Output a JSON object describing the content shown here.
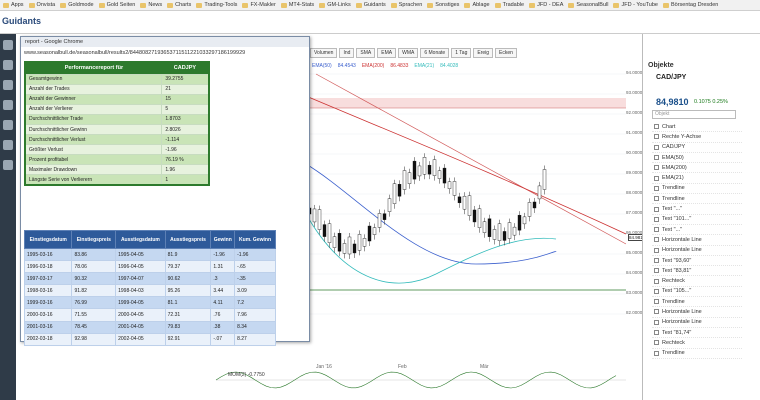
{
  "bookmarks": [
    "Apps",
    "Onvista",
    "Goldmode",
    "Gold Seiten",
    "News",
    "Charts",
    "Trading-Tools",
    "FX-Makler",
    "MT4-Stats",
    "GM-Links",
    "Guidants",
    "Sprachen",
    "Sonstiges",
    "Ablage",
    "Tradable",
    "JFD - DEA",
    "SeasonalBull",
    "JFD - YouTube",
    "Börsentag Dresden"
  ],
  "app": {
    "logo": "Guidants"
  },
  "popup": {
    "window_title": "report - Google Chrome",
    "url": "www.seasonalbull.de/seasonalbull/results2/84480827193653711511221033297186199929",
    "perf_header_left": "Performancereport für",
    "perf_header_right": "CADJPY",
    "perf_rows": [
      [
        "Gesamtgewinn",
        "39.2755"
      ],
      [
        "Anzahl der Trades",
        "21"
      ],
      [
        "Anzahl der Gewinner",
        "15"
      ],
      [
        "Anzahl der Verlierer",
        "5"
      ],
      [
        "Durchschnittlicher Trade",
        "1.8703"
      ],
      [
        "Durchschnittlicher Gewinn",
        "2.8026"
      ],
      [
        "Durchschnittlicher Verlust",
        "-1.114"
      ],
      [
        "Größter Verlust",
        "-1.96"
      ],
      [
        "Prozent profitabel",
        "76.19 %"
      ],
      [
        "Maximaler Drawdown",
        "1.96"
      ],
      [
        "Längste Serie von Verlierern",
        "1"
      ]
    ],
    "trade_headers": [
      "Einstiegsdatum",
      "Einstiegspreis",
      "Ausstiegsdatum",
      "Ausstiegspreis",
      "Gewinn",
      "Kum. Gewinn"
    ],
    "trade_rows": [
      [
        "1995-03-16",
        "83.86",
        "1995-04-05",
        "81.9",
        "-1.96",
        "-1.96"
      ],
      [
        "1996-03-18",
        "78.06",
        "1996-04-05",
        "79.37",
        "1.31",
        "-.65"
      ],
      [
        "1997-03-17",
        "90.32",
        "1997-04-07",
        "90.62",
        ".3",
        "-.35"
      ],
      [
        "1998-03-16",
        "91.82",
        "1998-04-03",
        "95.26",
        "3.44",
        "3.09"
      ],
      [
        "1999-03-16",
        "76.99",
        "1999-04-05",
        "81.1",
        "4.11",
        "7.2"
      ],
      [
        "2000-03-16",
        "71.55",
        "2000-04-05",
        "72.31",
        ".76",
        "7.96"
      ],
      [
        "2001-03-16",
        "78.45",
        "2001-04-05",
        "79.83",
        ".38",
        "8.34"
      ],
      [
        "2002-03-18",
        "92.98",
        "2002-04-05",
        "92.91",
        "-.07",
        "8.27"
      ]
    ]
  },
  "chart": {
    "toolbar": [
      "Volumen",
      "Ind",
      "SMA",
      "EMA",
      "WMA",
      "6 Monate",
      "1 Tag",
      "Ereig",
      "Ecken"
    ],
    "ema_labels": [
      "EMA(50)",
      "84.4543",
      "EMA(200)",
      "86.4833",
      "EMA(21)",
      "84.4028"
    ],
    "price_flag": "84.9810",
    "axis_labels": [
      "94.0000",
      "93.0000",
      "92.0000",
      "91.0000",
      "90.0000",
      "89.0000",
      "88.0000",
      "87.0000",
      "86.0000",
      "85.0000",
      "84.0000",
      "83.0000",
      "82.0000"
    ],
    "x_labels": [
      "Jan '16",
      "Feb",
      "Mär"
    ],
    "mom_label": "MOM(2)  -0.7750",
    "mom_axis": [
      "82.0000",
      "80.0000"
    ]
  },
  "objects_panel": {
    "title": "Objekte",
    "symbol": "CAD/JPY",
    "price": "84,9810",
    "change": "0.1075  0.25%",
    "search_placeholder": "Objekt",
    "items": [
      "Chart",
      "Rechte Y-Achse",
      "CAD/JPY",
      "EMA(50)",
      "EMA(200)",
      "EMA(21)",
      "Trendline",
      "Trendline",
      "Text \"...\"",
      "Text \"101...\"",
      "Text \"...\"",
      "Horizontale Line",
      "Horizontale Line",
      "Text \"93,60\"",
      "Text \"83,81\"",
      "Rechteck",
      "Text \"105...\"",
      "Trendline",
      "Horizontale Line",
      "Horizontale Line",
      "Text \"81,74\"",
      "Rechteck",
      "Trendline"
    ]
  },
  "colors": {
    "green": "#2d7a2d",
    "blue": "#2e5a9a",
    "ema50": "#3a5fcd",
    "ema200": "#cc3333",
    "ema21": "#33bbbb"
  }
}
